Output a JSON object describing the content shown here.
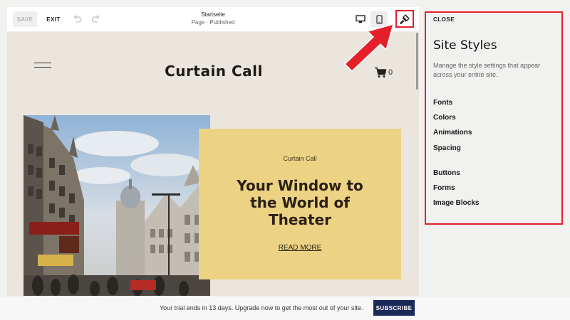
{
  "toolbar": {
    "save_label": "SAVE",
    "exit_label": "EXIT",
    "page_title": "Startseite",
    "page_status": "Page · Published",
    "icons": [
      "undo-icon",
      "redo-icon",
      "desktop-icon",
      "mobile-icon",
      "paintbrush-icon"
    ]
  },
  "site": {
    "title": "Curtain Call",
    "cart_count": "0",
    "hero": {
      "eyebrow": "Curtain Call",
      "heading_line1": "Your Window to",
      "heading_line2": "the World of",
      "heading_line3": "Theater",
      "link_label": "READ MORE",
      "card_color": "#ecd283"
    },
    "background_color": "#ebe6dd"
  },
  "panel": {
    "close_label": "CLOSE",
    "title": "Site Styles",
    "description": "Manage the style settings that appear across your entire site.",
    "items": [
      {
        "label": "Fonts"
      },
      {
        "label": "Colors"
      },
      {
        "label": "Animations"
      },
      {
        "label": "Spacing"
      },
      {
        "label": "Buttons"
      },
      {
        "label": "Forms"
      },
      {
        "label": "Image Blocks"
      }
    ]
  },
  "trial": {
    "message": "Your trial ends in 13 days. Upgrade now to get the most out of your site.",
    "subscribe_label": "SUBSCRIBE",
    "button_color": "#1a2a5a"
  },
  "highlight_color": "#e5202a"
}
